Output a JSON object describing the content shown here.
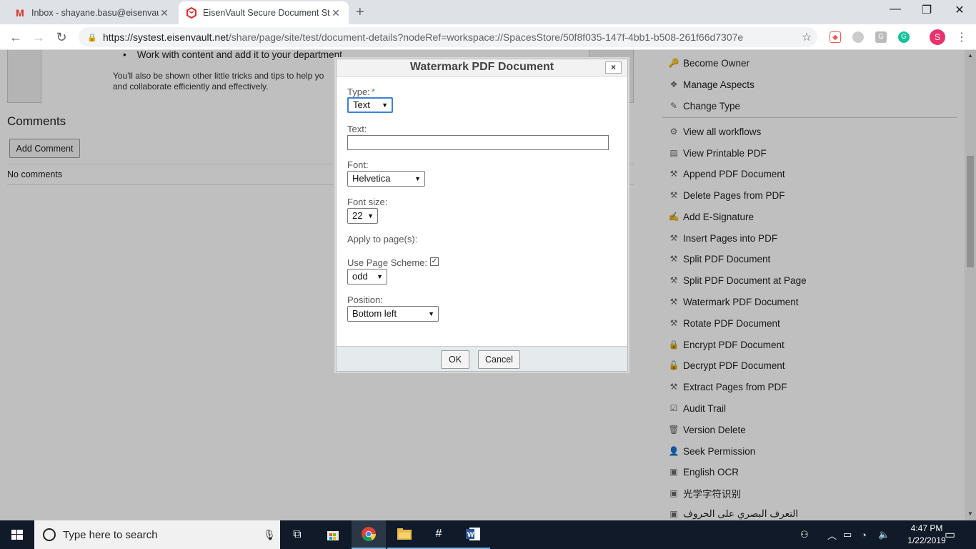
{
  "browser": {
    "tabs": [
      {
        "title": "Inbox - shayane.basu@eisenvault",
        "favicon": "gmail-icon"
      },
      {
        "title": "EisenVault Secure Document Stor",
        "favicon": "eisenvault-icon"
      }
    ],
    "new_tab_symbol": "+",
    "url_host": "https://systest.eisenvault.net",
    "url_path": "/share/page/site/test/document-details?nodeRef=workspace://SpacesStore/50f8f035-147f-4bb1-b508-261f66d7307e",
    "profile_initial": "S"
  },
  "document": {
    "bullet": "Work with content and add it to your department",
    "tips_line1": "You'll also be shown other little tricks and tips to help yo",
    "tips_line2": "and collaborate efficiently and effectively.",
    "comments_title": "Comments",
    "add_comment": "Add Comment",
    "no_comments": "No comments"
  },
  "actions": [
    {
      "label": "Become Owner",
      "icon": "key-icon"
    },
    {
      "label": "Manage Aspects",
      "icon": "aspects-icon"
    },
    {
      "label": "Change Type",
      "icon": "pencil-icon"
    },
    {
      "label": "View all workflows",
      "icon": "workflow-icon"
    },
    {
      "label": "View Printable PDF",
      "icon": "pdf-icon"
    },
    {
      "label": "Append PDF Document",
      "icon": "pdf-tool-icon"
    },
    {
      "label": "Delete Pages from PDF",
      "icon": "pdf-tool-icon"
    },
    {
      "label": "Add E-Signature",
      "icon": "signature-icon"
    },
    {
      "label": "Insert Pages into PDF",
      "icon": "pdf-tool-icon"
    },
    {
      "label": "Split PDF Document",
      "icon": "pdf-tool-icon"
    },
    {
      "label": "Split PDF Document at Page",
      "icon": "pdf-tool-icon"
    },
    {
      "label": "Watermark PDF Document",
      "icon": "pdf-tool-icon"
    },
    {
      "label": "Rotate PDF Document",
      "icon": "pdf-tool-icon"
    },
    {
      "label": "Encrypt PDF Document",
      "icon": "lock-icon"
    },
    {
      "label": "Decrypt PDF Document",
      "icon": "unlock-icon"
    },
    {
      "label": "Extract Pages from PDF",
      "icon": "pdf-tool-icon"
    },
    {
      "label": "Audit Trail",
      "icon": "checklist-icon"
    },
    {
      "label": "Version Delete",
      "icon": "trash-icon"
    },
    {
      "label": "Seek Permission",
      "icon": "person-lock-icon"
    },
    {
      "label": "English OCR",
      "icon": "ocr-icon"
    },
    {
      "label": "光学字符识别",
      "icon": "ocr-icon"
    },
    {
      "label": "التعرف البصري على الحروف",
      "icon": "ocr-icon"
    }
  ],
  "dialog": {
    "title": "Watermark PDF Document",
    "close": "×",
    "type_label": "Type:",
    "required_mark": "*",
    "type_value": "Text",
    "text_label": "Text:",
    "text_value": "",
    "font_label": "Font:",
    "font_value": "Helvetica",
    "fontsize_label": "Font size:",
    "fontsize_value": "22",
    "apply_label": "Apply to page(s):",
    "scheme_label": "Use Page Scheme:",
    "scheme_checked": true,
    "scheme_value": "odd",
    "position_label": "Position:",
    "position_value": "Bottom left",
    "ok": "OK",
    "cancel": "Cancel"
  },
  "taskbar": {
    "search_placeholder": "Type here to search",
    "time": "4:47 PM",
    "date": "1/22/2019"
  }
}
